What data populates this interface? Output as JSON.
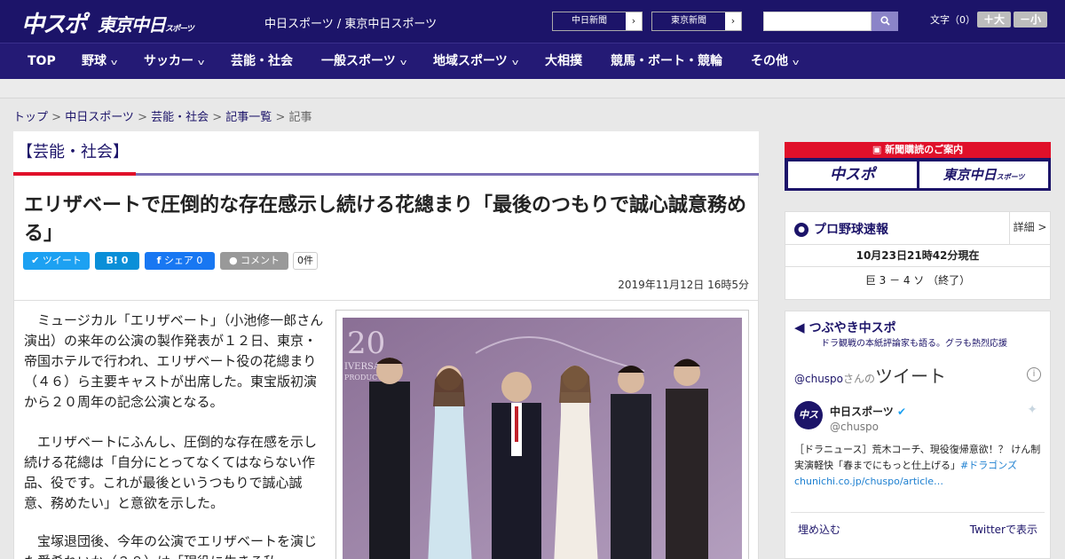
{
  "header": {
    "logo_main": "中スポ",
    "logo_sub": "東京中日",
    "logo_sub_small": "スポーツ",
    "site_names": "中日スポーツ / 東京中日スポーツ",
    "site_buttons": [
      "中日新聞",
      "東京新聞"
    ],
    "search_placeholder": "",
    "font_size_label": "文字（0）",
    "font_larger": "＋大",
    "font_smaller": "－小"
  },
  "nav": {
    "items": [
      "TOP",
      "野球",
      "サッカー",
      "芸能・社会",
      "一般スポーツ",
      "地域スポーツ",
      "大相撲",
      "競馬・ボート・競輪",
      "その他"
    ]
  },
  "breadcrumb": [
    "トップ",
    "中日スポーツ",
    "芸能・社会",
    "記事一覧",
    "記事"
  ],
  "article": {
    "category": "【芸能・社会】",
    "title": "エリザベートで圧倒的な存在感示し続ける花總まり「最後のつもりで誠心誠意務める」",
    "share": {
      "tweet": "ツイート",
      "hatena_count": "0",
      "facebook": "シェア 0",
      "comment": "コメント",
      "comment_count": "0件"
    },
    "date": "2019年11月12日 16時5分",
    "paragraphs": [
      "　ミュージカル「エリザベート」（小池修一郎さん演出）の来年の公演の製作発表が１２日、東京・帝国ホテルで行われ、エリザベート役の花總まり（４６）ら主要キャストが出席した。東宝版初演から２０周年の記念公演となる。",
      "　エリザベートにふんし、圧倒的な存在感を示し続ける花總は「自分にとってなくてはならない作品、役です。これが最後というつもりで誠心誠意、務めたい」と意欲を示した。",
      "　宝塚退団後、今年の公演でエリザベートを演じた愛希れいか（２８）は「現役に生きる私"
    ],
    "photo_text": [
      "20",
      "IVERSARY",
      "PRODUCTION"
    ]
  },
  "sidebar": {
    "subscribe_head": "新聞購読のご案内",
    "subscribe_a": "中スポ",
    "subscribe_b": "東京中日",
    "subscribe_b_small": "スポーツ",
    "baseball": {
      "title": "プロ野球速報",
      "more": "詳細 >",
      "time": "10月23日21時42分現在",
      "score": "巨 3 － 4 ソ （終了）"
    },
    "tweets": {
      "title": "つぶやき中スポ",
      "subtitle": "ドラ観戦の本紙評論家も語る。グラも熱烈応援",
      "handle_line_a": "@chuspo",
      "handle_line_b": "さんの",
      "handle_line_c": "ツイート",
      "user_name": "中日スポーツ",
      "user_handle": "@chuspo",
      "tweet_text": "［ドラニュース］荒木コーチ、現役復帰意欲！？ けん制実演軽快「春までにもっと仕上げる」",
      "tweet_link": "#ドラゴンズchunichi.co.jp/chuspo/article…",
      "embed": "埋め込む",
      "view_on": "Twitterで表示"
    }
  },
  "colors": {
    "brand": "#1c1469",
    "accent": "#e0102a",
    "twitter": "#1da1f2"
  }
}
